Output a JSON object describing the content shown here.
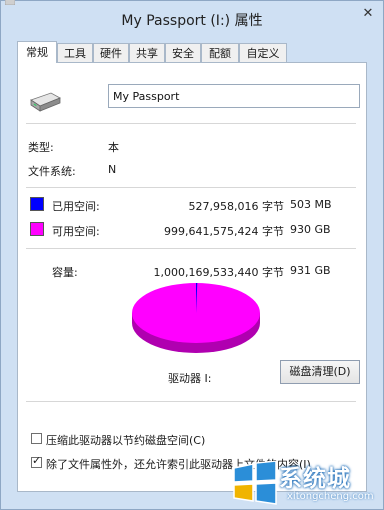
{
  "window": {
    "title": "My Passport (I:) 属性",
    "close_label": "✕"
  },
  "tabs": [
    {
      "label": "常规",
      "active": true
    },
    {
      "label": "工具"
    },
    {
      "label": "硬件"
    },
    {
      "label": "共享"
    },
    {
      "label": "安全"
    },
    {
      "label": "配额"
    },
    {
      "label": "自定义"
    }
  ],
  "general": {
    "drive_name_value": "My Passport",
    "type_label": "类型:",
    "type_value": "本",
    "filesystem_label": "文件系统:",
    "filesystem_value": "N",
    "used": {
      "label": "已用空间:",
      "bytes": "527,958,016 字节",
      "size": "503 MB",
      "color": "#0000ff"
    },
    "free": {
      "label": "可用空间:",
      "bytes": "999,641,575,424 字节",
      "size": "930 GB",
      "color": "#ff00ff"
    },
    "capacity": {
      "label": "容量:",
      "bytes": "1,000,169,533,440 字节",
      "size": "931 GB"
    },
    "drive_label": "驱动器 I:",
    "cleanup_button": "磁盘清理(D)",
    "compress_option": {
      "label": "压缩此驱动器以节约磁盘空间(C)",
      "checked": false
    },
    "index_option": {
      "label": "除了文件属性外，还允许索引此驱动器上文件的内容(I)",
      "checked": true
    }
  },
  "watermark": {
    "title": "系统城",
    "url": "xitongcheng.com"
  },
  "icons": {
    "drive": "external-drive-icon",
    "watermark_logo": "windows-logo-icon"
  }
}
